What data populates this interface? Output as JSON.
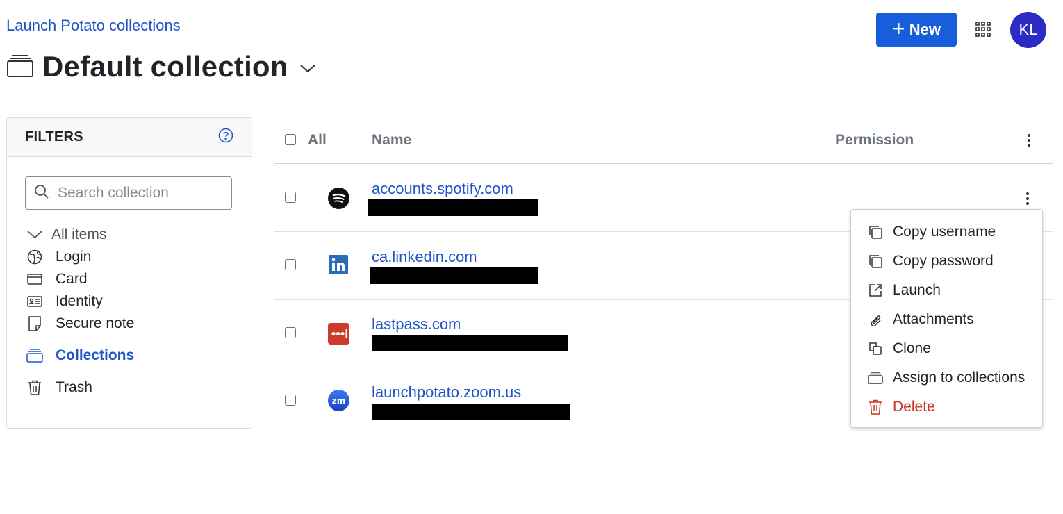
{
  "header": {
    "breadcrumb": "Launch Potato collections",
    "title": "Default collection",
    "new_label": "New",
    "avatar_initials": "KL"
  },
  "filters": {
    "title": "FILTERS",
    "search_placeholder": "Search collection",
    "all_items_label": "All items",
    "items": [
      {
        "label": "Login",
        "icon": "globe-icon"
      },
      {
        "label": "Card",
        "icon": "credit-card-icon"
      },
      {
        "label": "Identity",
        "icon": "id-card-icon"
      },
      {
        "label": "Secure note",
        "icon": "note-icon"
      }
    ],
    "collections_label": "Collections",
    "trash_label": "Trash"
  },
  "table": {
    "headers": {
      "all": "All",
      "name": "Name",
      "permission": "Permission"
    },
    "rows": [
      {
        "name": "accounts.spotify.com",
        "icon": "spotify-icon"
      },
      {
        "name": "ca.linkedin.com",
        "icon": "linkedin-icon"
      },
      {
        "name": "lastpass.com",
        "icon": "lastpass-icon"
      },
      {
        "name": "launchpotato.zoom.us",
        "icon": "zoom-icon"
      }
    ]
  },
  "context_menu": {
    "items": [
      {
        "label": "Copy username",
        "icon": "copy-icon"
      },
      {
        "label": "Copy password",
        "icon": "copy-icon"
      },
      {
        "label": "Launch",
        "icon": "launch-icon"
      },
      {
        "label": "Attachments",
        "icon": "paperclip-icon"
      },
      {
        "label": "Clone",
        "icon": "clone-icon"
      },
      {
        "label": "Assign to collections",
        "icon": "collection-icon"
      },
      {
        "label": "Delete",
        "icon": "trash-icon"
      }
    ]
  },
  "colors": {
    "accent": "#175ddc",
    "link": "#1f55c8",
    "danger": "#c83522",
    "avatar": "#2b2bc6"
  }
}
